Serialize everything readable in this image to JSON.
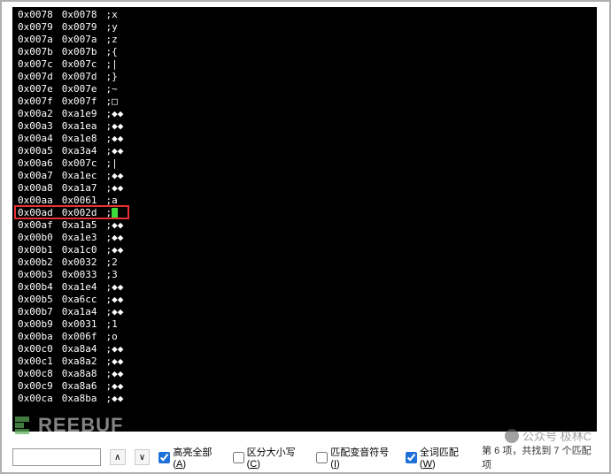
{
  "rows": [
    {
      "a1": "0x0078",
      "a2": "0x0078",
      "t": ";x"
    },
    {
      "a1": "0x0079",
      "a2": "0x0079",
      "t": ";y"
    },
    {
      "a1": "0x007a",
      "a2": "0x007a",
      "t": ";z"
    },
    {
      "a1": "0x007b",
      "a2": "0x007b",
      "t": ";{"
    },
    {
      "a1": "0x007c",
      "a2": "0x007c",
      "t": ";|"
    },
    {
      "a1": "0x007d",
      "a2": "0x007d",
      "t": ";}"
    },
    {
      "a1": "0x007e",
      "a2": "0x007e",
      "t": ";~"
    },
    {
      "a1": "0x007f",
      "a2": "0x007f",
      "t": ";□"
    },
    {
      "a1": "0x00a2",
      "a2": "0xa1e9",
      "t": ";◆◆"
    },
    {
      "a1": "0x00a3",
      "a2": "0xa1ea",
      "t": ";◆◆"
    },
    {
      "a1": "0x00a4",
      "a2": "0xa1e8",
      "t": ";◆◆"
    },
    {
      "a1": "0x00a5",
      "a2": "0xa3a4",
      "t": ";◆◆"
    },
    {
      "a1": "0x00a6",
      "a2": "0x007c",
      "t": ";|"
    },
    {
      "a1": "0x00a7",
      "a2": "0xa1ec",
      "t": ";◆◆"
    },
    {
      "a1": "0x00a8",
      "a2": "0xa1a7",
      "t": ";◆◆"
    },
    {
      "a1": "0x00aa",
      "a2": "0x0061",
      "t": ";a"
    },
    {
      "a1": "0x00ad",
      "a2": "0x002d",
      "t": ";",
      "highlight": true,
      "cursor": true
    },
    {
      "a1": "0x00af",
      "a2": "0xa1a5",
      "t": ";◆◆"
    },
    {
      "a1": "0x00b0",
      "a2": "0xa1e3",
      "t": ";◆◆"
    },
    {
      "a1": "0x00b1",
      "a2": "0xa1c0",
      "t": ";◆◆"
    },
    {
      "a1": "0x00b2",
      "a2": "0x0032",
      "t": ";2"
    },
    {
      "a1": "0x00b3",
      "a2": "0x0033",
      "t": ";3"
    },
    {
      "a1": "0x00b4",
      "a2": "0xa1e4",
      "t": ";◆◆"
    },
    {
      "a1": "0x00b5",
      "a2": "0xa6cc",
      "t": ";◆◆"
    },
    {
      "a1": "0x00b7",
      "a2": "0xa1a4",
      "t": ";◆◆"
    },
    {
      "a1": "0x00b9",
      "a2": "0x0031",
      "t": ";1"
    },
    {
      "a1": "0x00ba",
      "a2": "0x006f",
      "t": ";o"
    },
    {
      "a1": "0x00c0",
      "a2": "0xa8a4",
      "t": ";◆◆"
    },
    {
      "a1": "0x00c1",
      "a2": "0xa8a2",
      "t": ";◆◆"
    },
    {
      "a1": "0x00c8",
      "a2": "0xa8a8",
      "t": ";◆◆"
    },
    {
      "a1": "0x00c9",
      "a2": "0xa8a6",
      "t": ";◆◆"
    },
    {
      "a1": "0x00ca",
      "a2": "0xa8ba",
      "t": ";◆◆"
    }
  ],
  "highlight_row_index": 16,
  "search": {
    "value": "",
    "placeholder": ""
  },
  "checkboxes": {
    "highlight_all": {
      "label": "高亮全部(",
      "key": "A",
      "suffix": ")",
      "checked": true
    },
    "case_sensitive": {
      "label": "区分大小写(",
      "key": "C",
      "suffix": ")",
      "checked": false
    },
    "diacritics": {
      "label": "匹配变音符号(",
      "key": "I",
      "suffix": ")",
      "checked": false
    },
    "whole_word": {
      "label": "全词匹配(",
      "key": "W",
      "suffix": ")",
      "checked": true
    }
  },
  "status_text": "第 6 项，共找到 7 个匹配项",
  "watermark": "公众号    极林C",
  "freebuf": "REEBUF",
  "nav": {
    "up": "∧",
    "down": "∨"
  }
}
